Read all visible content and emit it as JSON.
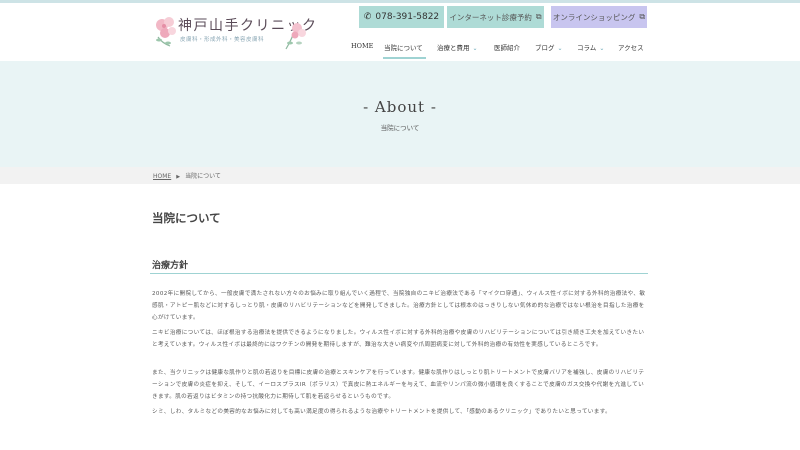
{
  "header": {
    "logo_title": "神戸山手クリニック",
    "logo_subtitle": "皮膚科・形成外科・美容皮膚科",
    "phone": "078-391-5822",
    "reserve_label": "インターネット診療予約",
    "shop_label": "オンラインショッピング",
    "nav": [
      {
        "label": "HOME"
      },
      {
        "label": "当院について"
      },
      {
        "label": "治療と費用"
      },
      {
        "label": "医師紹介"
      },
      {
        "label": "ブログ"
      },
      {
        "label": "コラム"
      },
      {
        "label": "アクセス"
      }
    ]
  },
  "hero": {
    "title": "- About -",
    "subtitle": "当院について"
  },
  "breadcrumb": {
    "home": "HOME",
    "current": "当院について"
  },
  "main": {
    "page_title": "当院について",
    "section_title": "治療方針",
    "paragraphs": [
      "2002年に開院してから、一般皮膚で満たされない方々のお悩みに取り組んでいく過程で、当院独自のニキビ治療法である「マイクロ穿通」、ウィルス性イボに対する外科的治療法や、敏感肌・アトピー肌などに対するしっとり肌・皮膚のリハビリテーションなどを開発してきました。治療方針としては根本のはっきりしない気休め的な治療ではない根治を目指した治療を心がけています。",
      "ニキビ治療については、ほぼ根治する治療法を提供できるようになりました。ウィルス性イボに対する外科的治療や皮膚のリハビリテーションについては引き続き工夫を加えていきたいと考えています。ウィルス性イボは最終的にはワクチンの開発を期待しますが、難治な大きい病変や爪周囲病変に対して外科的治療の有効性を実感しているところです。",
      "また、当クリニックは健康な肌作りと肌の若返りを目標に皮膚の治療とスキンケアを行っています。健康な肌作りはしっとり肌トリートメントで皮膚バリアを補強し、皮膚のリハビリテーションで皮膚の炎症を抑え、そして、イーロスプラスIR（ポラリス）で真皮に熱エネルギーを与えて、血流やリンパ流の微小循環を良くすることで皮膚のガス交換や代謝を亢進していきます。肌の若返りはビタミンの持つ抗酸化力に期待して肌を若返らせるというものです。",
      "シミ、しわ、タルミなどの美容的なお悩みに対しても高い満足度の得られるような治療やトリートメントを提供して、「感動のあるクリニック」でありたいと思っています。"
    ]
  },
  "colors": {
    "accent_teal": "#aedbd6",
    "accent_lavender": "#c8c5ef",
    "hero_bg": "#e9f4f5",
    "rule": "#9fd3d3"
  },
  "icons": {
    "phone": "phone-icon",
    "external": "external-link-icon",
    "chevron": "chevron-down-icon"
  }
}
